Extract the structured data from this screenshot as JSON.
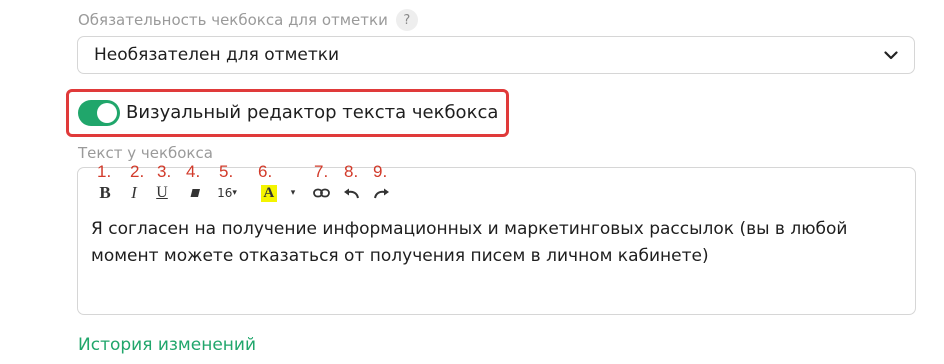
{
  "required_field": {
    "label": "Обязательность чекбокса для отметки",
    "help": "?",
    "select_value": "Необязателен для отметки"
  },
  "visual_editor": {
    "label": "Визуальный редактор текста чекбокса",
    "enabled": true
  },
  "checkbox_text": {
    "label": "Текст у чекбокса",
    "font_size": "16",
    "content": "Я согласен на получение информационных и маркетинговых рассылок (вы в любой момент можете отказаться от получения писем в личном кабинете)"
  },
  "toolbar_numbers": [
    "1.",
    "2.",
    "3.",
    "4.",
    "5.",
    "6.",
    "7.",
    "8.",
    "9."
  ],
  "toolbar": {
    "bold": "B",
    "italic": "I",
    "underline": "U",
    "color": "A"
  },
  "history_link": "История изменений",
  "colors": {
    "accent": "#20a66b",
    "annotation": "#d23a2a",
    "highlight_box": "#e03a3a"
  }
}
